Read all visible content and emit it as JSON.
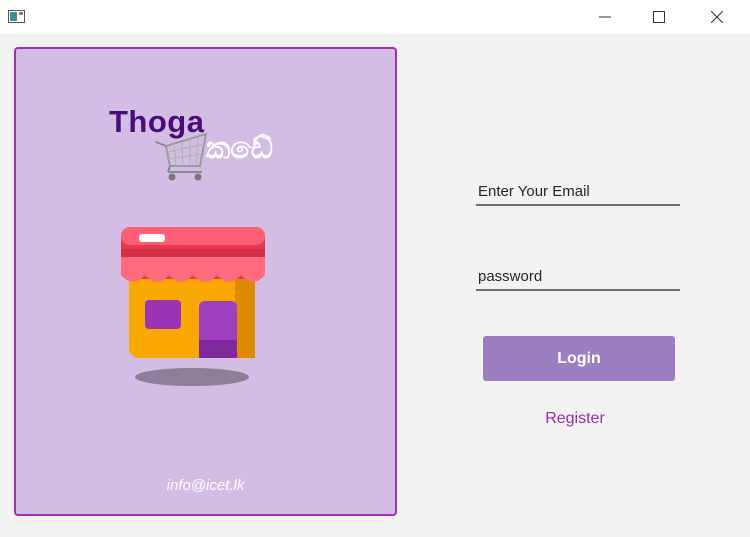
{
  "window": {
    "icons": {
      "app": "app-window-icon",
      "minimize": "minimize-icon",
      "maximize": "maximize-icon",
      "close": "close-icon"
    }
  },
  "brand": {
    "title": "Thoga",
    "subtitle": "කඩේ",
    "email": "info@icet.lk",
    "icons": {
      "cart": "shopping-cart-icon",
      "shop": "shop-illustration"
    },
    "colors": {
      "panel": "#d4bde5",
      "border": "#a82ab8",
      "title": "#4a0d78"
    }
  },
  "form": {
    "email_placeholder": "Enter Your Email",
    "email_value": "",
    "password_placeholder": "password",
    "password_value": "",
    "login_label": "Login",
    "register_label": "Register",
    "colors": {
      "login_button": "#9b7fc0",
      "register_link": "#9d2ab2"
    }
  }
}
